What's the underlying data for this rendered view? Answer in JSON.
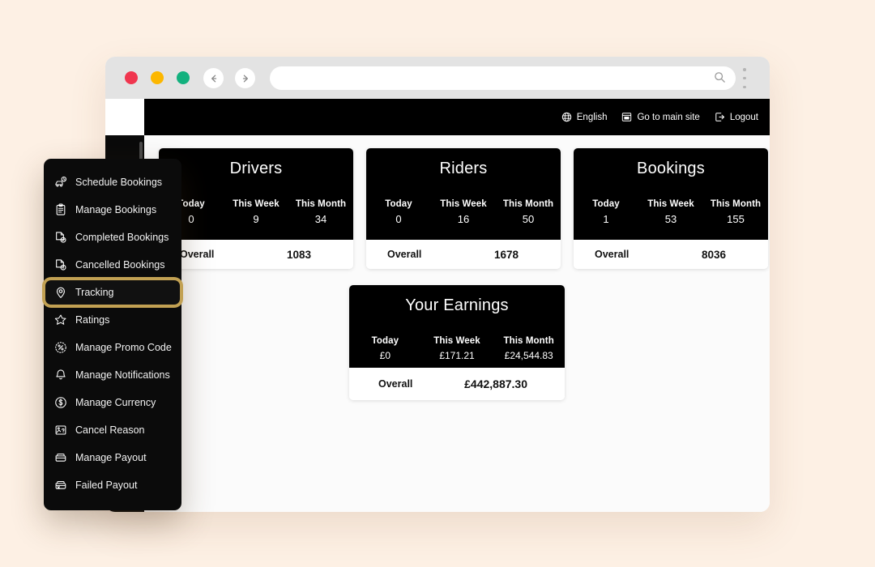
{
  "background_color": "#fdf0e4",
  "browser": {
    "window_buttons": [
      "close",
      "minimize",
      "maximize"
    ],
    "colors": {
      "close": "#f0364f",
      "minimize": "#fcb700",
      "maximize": "#13b17e"
    },
    "back_label": "Back",
    "forward_label": "Forward",
    "address_value": "",
    "address_placeholder": "",
    "search_icon": "search-icon",
    "menu_icon": "kebab-menu-icon"
  },
  "topbar": {
    "items": [
      {
        "icon": "globe-icon",
        "label": "English"
      },
      {
        "icon": "window-icon",
        "label": "Go to main site"
      },
      {
        "icon": "logout-icon",
        "label": "Logout"
      }
    ]
  },
  "cards": [
    {
      "title": "Drivers",
      "columns": [
        {
          "label": "Today",
          "value": "0"
        },
        {
          "label": "This Week",
          "value": "9"
        },
        {
          "label": "This Month",
          "value": "34"
        }
      ],
      "overall_label": "Overall",
      "overall_value": "1083"
    },
    {
      "title": "Riders",
      "columns": [
        {
          "label": "Today",
          "value": "0"
        },
        {
          "label": "This Week",
          "value": "16"
        },
        {
          "label": "This Month",
          "value": "50"
        }
      ],
      "overall_label": "Overall",
      "overall_value": "1678"
    },
    {
      "title": "Bookings",
      "columns": [
        {
          "label": "Today",
          "value": "1"
        },
        {
          "label": "This Week",
          "value": "53"
        },
        {
          "label": "This Month",
          "value": "155"
        }
      ],
      "overall_label": "Overall",
      "overall_value": "8036"
    }
  ],
  "earnings_card": {
    "title": "Your Earnings",
    "columns": [
      {
        "label": "Today",
        "value": "£0"
      },
      {
        "label": "This Week",
        "value": "£171.21"
      },
      {
        "label": "This Month",
        "value": "£24,544.83"
      }
    ],
    "overall_label": "Overall",
    "overall_value": "£442,887.30"
  },
  "flyout_menu": {
    "active_item": "Tracking",
    "highlight_color": "#c2a153",
    "items": [
      {
        "icon": "schedule-car-icon",
        "label": "Schedule Bookings"
      },
      {
        "icon": "clipboard-icon",
        "label": "Manage Bookings"
      },
      {
        "icon": "document-check-icon",
        "label": "Completed Bookings"
      },
      {
        "icon": "document-cancel-icon",
        "label": "Cancelled Bookings"
      },
      {
        "icon": "location-pin-icon",
        "label": "Tracking"
      },
      {
        "icon": "star-icon",
        "label": "Ratings"
      },
      {
        "icon": "promo-percent-icon",
        "label": "Manage Promo Code"
      },
      {
        "icon": "bell-icon",
        "label": "Manage Notifications"
      },
      {
        "icon": "currency-dollar-icon",
        "label": "Manage Currency"
      },
      {
        "icon": "image-question-icon",
        "label": "Cancel Reason"
      },
      {
        "icon": "wallet-icon",
        "label": "Manage Payout"
      },
      {
        "icon": "wallet-failed-icon",
        "label": "Failed Payout"
      }
    ]
  }
}
